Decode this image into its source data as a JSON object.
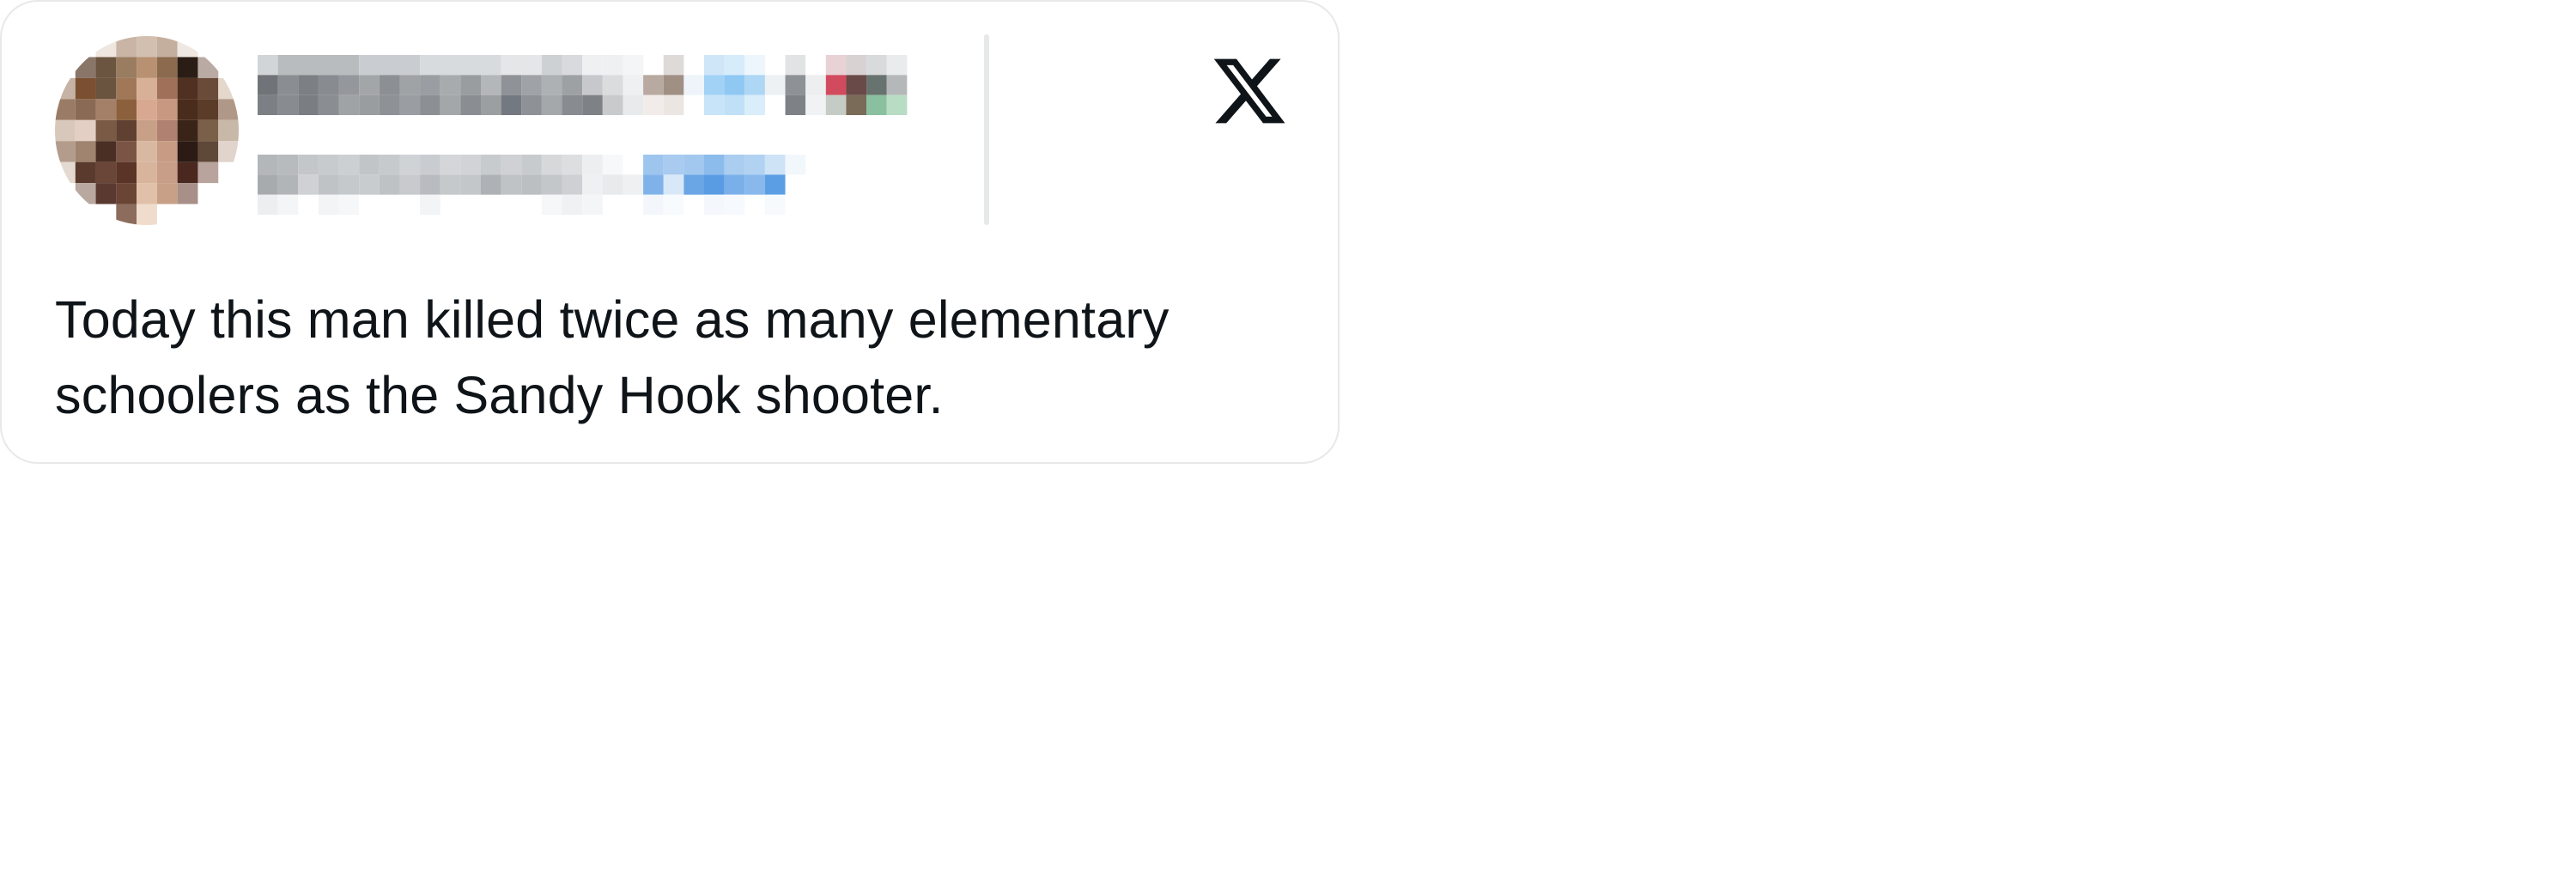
{
  "author": {
    "avatar_icon": "redacted-avatar-icon",
    "name_redacted": "pixelated-display-name",
    "handle_redacted": "pixelated-handle-and-follow-link",
    "accent_color": "#1d9bf0"
  },
  "brand": {
    "icon": "x-logo-icon",
    "color": "#0f1419"
  },
  "tweet": {
    "text": "Today this man killed twice as many elementary schoolers as the Sandy Hook shooter."
  },
  "theme": {
    "background": "#ffffff",
    "border": "#e6e8ea",
    "text": "#0f1419"
  }
}
